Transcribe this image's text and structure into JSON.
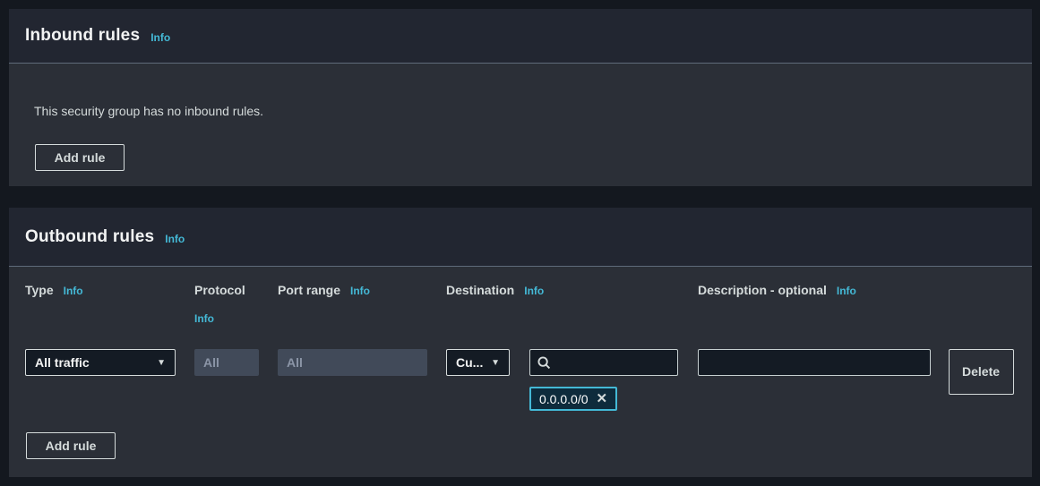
{
  "colors": {
    "page_background": "#14181f",
    "panel_header_background": "#222631",
    "panel_body_background": "#2b2f37",
    "divider": "#5f6b7a",
    "title_text": "#f2f3f3",
    "body_text": "#d5dbdb",
    "info_link": "#44b9d6",
    "input_background": "#141b24",
    "disabled_input_background": "#414a59",
    "disabled_input_text": "#8b95a7",
    "token_background": "#0e2b3c",
    "token_border": "#44b9d6"
  },
  "inbound": {
    "title": "Inbound rules",
    "info_label": "Info",
    "empty_message": "This security group has no inbound rules.",
    "add_rule_label": "Add rule"
  },
  "outbound": {
    "title": "Outbound rules",
    "info_label": "Info",
    "add_rule_label": "Add rule",
    "columns": [
      {
        "label": "Type",
        "info": "Info"
      },
      {
        "label": "Protocol",
        "info": "Info"
      },
      {
        "label": "Port range",
        "info": "Info"
      },
      {
        "label": "Destination",
        "info": "Info"
      },
      {
        "label": "Description - optional",
        "info": "Info"
      }
    ],
    "row": {
      "type_value": "All traffic",
      "protocol_value": "All",
      "port_range_value": "All",
      "destination_type_value": "Cu...",
      "destination_search_value": "",
      "destination_token": "0.0.0.0/0",
      "description_value": "",
      "delete_label": "Delete"
    },
    "icons": {
      "caret": "▼",
      "dismiss": "✕"
    }
  }
}
